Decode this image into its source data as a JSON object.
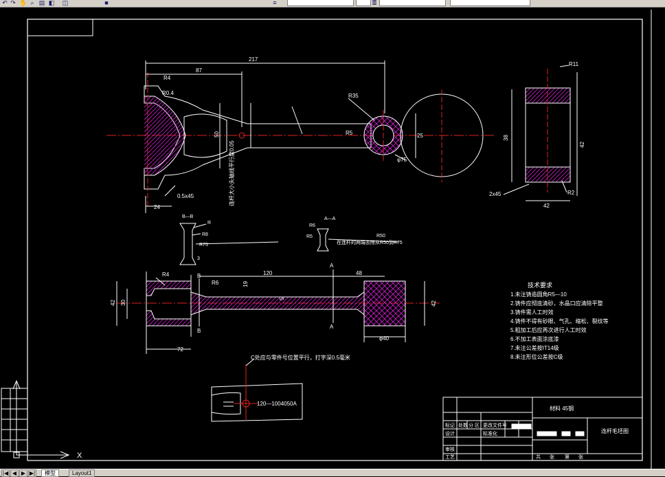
{
  "toolbar": {
    "icons": [
      "undo-icon",
      "redo-icon",
      "pan-icon",
      "zoom-icon",
      "properties-icon",
      "layer-icon",
      "layer-state-icon",
      "color-icon",
      "linetype-icon",
      "lineweight-icon"
    ]
  },
  "drawing": {
    "dims": {
      "d217": "217",
      "d87": "87",
      "r4": "R4",
      "r04": "R0.4",
      "r35": "R35",
      "r5": "R5",
      "d25": "25",
      "d75": "φ75",
      "chamfer_left": "0.5x45",
      "d24": "24",
      "d50": "50",
      "r11": "R11",
      "d38": "38",
      "d42r": "42",
      "x45_note": "2x45 ",
      "r2": "R2",
      "d42_bottom": "42",
      "d120": "120",
      "d48": "48",
      "d42_left": "42",
      "d30": "30",
      "r4b": "R4",
      "r6b": "R6",
      "d19": "19",
      "d5": "5",
      "d40": "φ40",
      "d42_right": "42",
      "d72": "72",
      "d3": "3",
      "sec_a": "A",
      "sec_b": "B",
      "aa": "A—A",
      "bb": "B—B",
      "r_top": "R",
      "r8": "R8",
      "r75": "R75",
      "r6": "R6",
      "r50": "R50",
      "r5b": "R5",
      "part_no": "120—1004050A"
    },
    "notes": {
      "title": "技术要求",
      "lines": [
        "1.未注铸造圆角R5—10",
        "2.铸件应彻底清砂，水晶口应清除平整",
        "3.铸件需人工时效",
        "4.铸件不得有砂眼、气孔、缩松、裂纹等",
        "5.粗加工后应再次进行人工时效",
        "6.不加工表面涂底漆",
        "7.未注公差按IT14级",
        "8.未注形位公差按C级"
      ],
      "left_vertical": "连杆大小头轴线平行度0.05",
      "aa_note": "在连杆的两端去除从R50到R75",
      "bottom_note": "C处应与零件号位置平行，打字深0.5毫米"
    },
    "title_block": {
      "material": "材料 45钢",
      "name": "连杆毛坯图",
      "row_labels": [
        "设计",
        "审核",
        "工艺"
      ],
      "headers": [
        "标记",
        "处数",
        "分 区",
        "更改文件号",
        "签名",
        "年月日"
      ],
      "standard": "标准化",
      "bottom": [
        "共",
        "张",
        "第",
        "张"
      ]
    }
  },
  "ucs": {
    "x": "X",
    "y": "Y"
  },
  "statusbar": {
    "nav": [
      "|◀",
      "◀",
      "▶",
      "▶|"
    ],
    "tabs": [
      "模型",
      "Layout1"
    ]
  }
}
